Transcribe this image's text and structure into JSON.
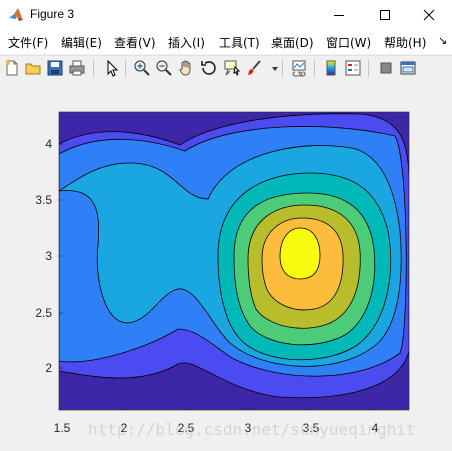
{
  "window": {
    "title": "Figure 3"
  },
  "menu": [
    {
      "label": "文件(F)"
    },
    {
      "label": "编辑(E)"
    },
    {
      "label": "查看(V)"
    },
    {
      "label": "插入(I)"
    },
    {
      "label": "工具(T)"
    },
    {
      "label": "桌面(D)"
    },
    {
      "label": "窗口(W)"
    },
    {
      "label": "帮助(H)"
    }
  ],
  "toolbar": {
    "icons": [
      "new-figure-icon",
      "open-file-icon",
      "save-icon",
      "print-icon",
      "select-pointer-icon",
      "zoom-in-icon",
      "zoom-out-icon",
      "pan-hand-icon",
      "rotate-3d-icon",
      "data-cursor-icon",
      "brush-icon",
      "link-plot-icon",
      "colorbar-icon",
      "legend-icon",
      "hide-plot-tools-icon",
      "show-plot-tools-icon"
    ]
  },
  "plot": {
    "x_ticks": [
      "1.5",
      "2",
      "2.5",
      "3",
      "3.5",
      "4"
    ],
    "y_ticks": [
      "2",
      "2.5",
      "3",
      "3.5",
      "4"
    ]
  },
  "chart_data": {
    "type": "contour",
    "xlim": [
      1.5,
      4.3
    ],
    "ylim": [
      1.6,
      4.3
    ],
    "x_ticks": [
      1.5,
      2,
      2.5,
      3,
      3.5,
      4
    ],
    "y_ticks": [
      2,
      2.5,
      3,
      3.5,
      4
    ],
    "peak": {
      "x": 3.45,
      "y": 3.0
    },
    "levels": 8,
    "colors": [
      "#3e26a8",
      "#4a4bf0",
      "#2f80f6",
      "#1aa6e0",
      "#00b8b8",
      "#4ccc78",
      "#b8bd2c",
      "#fdbd3c",
      "#f9fb0e"
    ]
  },
  "watermark": "http://blog.csdn.net/sunyueqinghit"
}
